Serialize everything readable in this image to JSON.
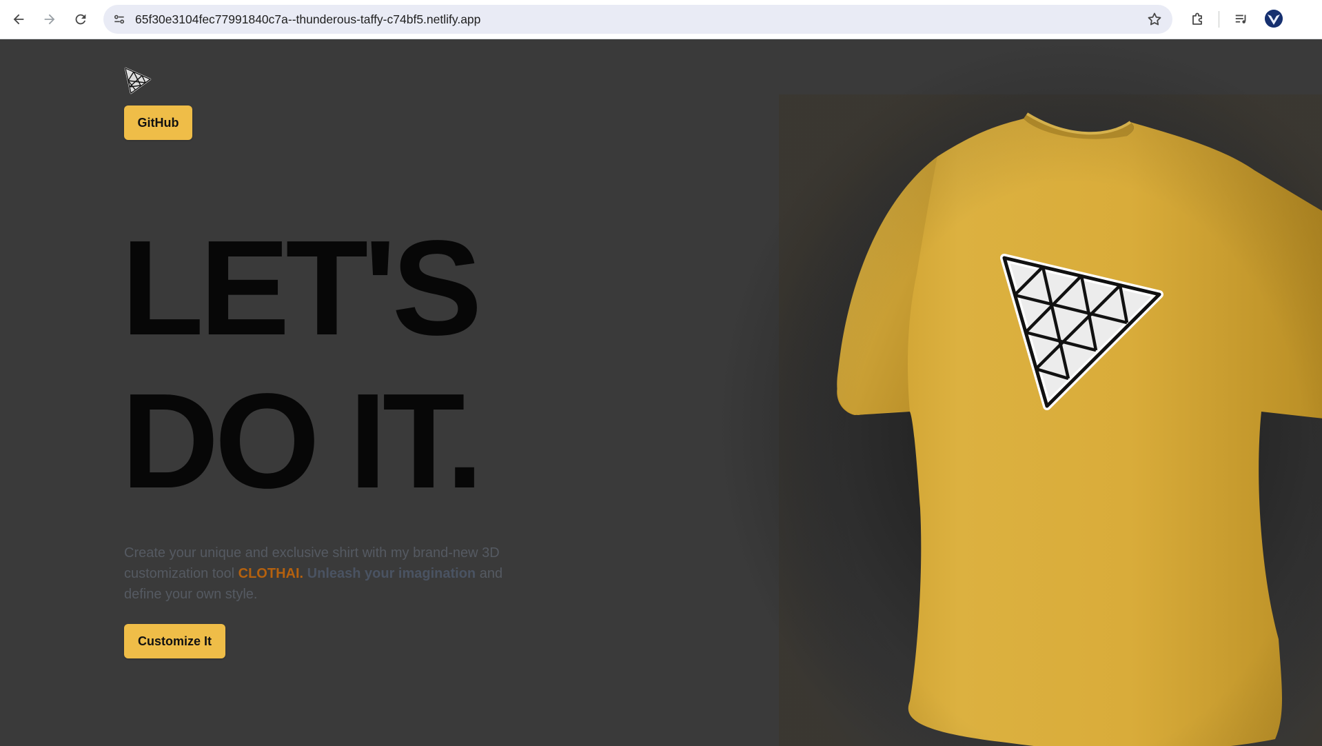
{
  "browser": {
    "url": "65f30e3104fec77991840c7a--thunderous-taffy-c74bf5.netlify.app",
    "icons": {
      "back": "back-arrow-icon",
      "forward": "forward-arrow-icon",
      "reload": "reload-icon",
      "site_info": "tune-icon",
      "bookmark": "star-icon",
      "extensions": "puzzle-icon",
      "media": "media-queue-icon",
      "profile": "avatar"
    }
  },
  "hero": {
    "github_label": "GitHub",
    "headline_line1": "LET'S",
    "headline_line2": "DO IT.",
    "description_part1": "Create your unique and exclusive shirt with my brand-new 3D customization tool ",
    "brand": "CLOTHAI",
    "description_part2": ". ",
    "highlight": "Unleash your imagination",
    "description_part3": " and define your own style.",
    "cta_label": "Customize It"
  },
  "colors": {
    "background": "#3a3a3a",
    "accent": "#efbd48",
    "shirt": "#d9ad3c",
    "brand_text": "#b5610e"
  }
}
